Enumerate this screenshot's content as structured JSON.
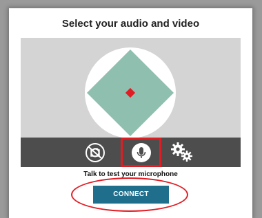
{
  "dialog": {
    "title": "Select your audio and video",
    "mic_hint": "Talk to test your microphone",
    "connect_label": "CONNECT"
  },
  "preview": {
    "placeholder_shape": "diamond-in-circle",
    "diamond_color": "#8fbfaf",
    "dot_color": "#e11d24"
  },
  "toolbar": {
    "buttons": [
      {
        "name": "camera-off",
        "icon": "camera-off-icon"
      },
      {
        "name": "microphone",
        "icon": "microphone-icon",
        "selected": true
      },
      {
        "name": "settings",
        "icon": "gears-icon"
      }
    ]
  },
  "colors": {
    "accent_red": "#e11d24",
    "connect_blue": "#1f6e8c",
    "toolbar_bg": "#4d4d4d",
    "preview_bg": "#d4d4d4"
  }
}
